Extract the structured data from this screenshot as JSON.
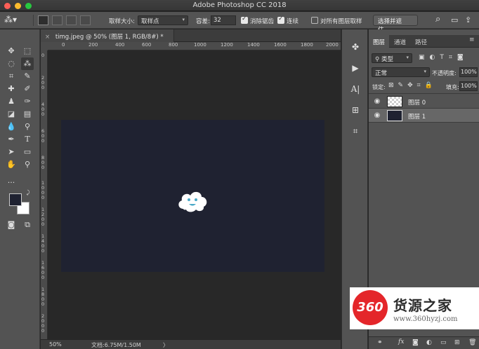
{
  "window": {
    "title": "Adobe Photoshop CC 2018"
  },
  "options": {
    "sample_size_label": "取样大小:",
    "sample_size_value": "取样点",
    "tolerance_label": "容差:",
    "tolerance_value": "32",
    "antialias_label": "消除锯齿",
    "contiguous_label": "连续",
    "sample_all_label": "对所有图层取样",
    "select_mask_button": "选择并遮住..."
  },
  "document": {
    "tab_title": "timg.jpeg @ 50% (图层 1, RGB/8#) *",
    "ruler_h": [
      "0",
      "200",
      "400",
      "600",
      "800",
      "1000",
      "1200",
      "1400",
      "1600",
      "1800",
      "2000"
    ],
    "ruler_v": [
      "0",
      "200",
      "400",
      "600",
      "800",
      "1000",
      "1200",
      "1400",
      "1600",
      "1800",
      "2000"
    ],
    "zoom": "50%",
    "doc_info": "文档:6.75M/1.50M"
  },
  "layers_panel": {
    "tabs": [
      "图层",
      "通道",
      "路径"
    ],
    "filter_label": "类型",
    "blend_mode": "正常",
    "opacity_label": "不透明度:",
    "opacity_value": "100%",
    "lock_label": "锁定:",
    "fill_label": "填充:",
    "fill_value": "100%",
    "layers": [
      {
        "name": "图层 0",
        "selected": false
      },
      {
        "name": "图层 1",
        "selected": true
      }
    ]
  },
  "watermark": {
    "badge": "360",
    "name": "货源之家",
    "url": "www.360hyzj.com"
  },
  "colors": {
    "canvas": "#1f2231",
    "foreground": "#1f2231",
    "background": "#ffffff",
    "accent": "#e4262a"
  }
}
